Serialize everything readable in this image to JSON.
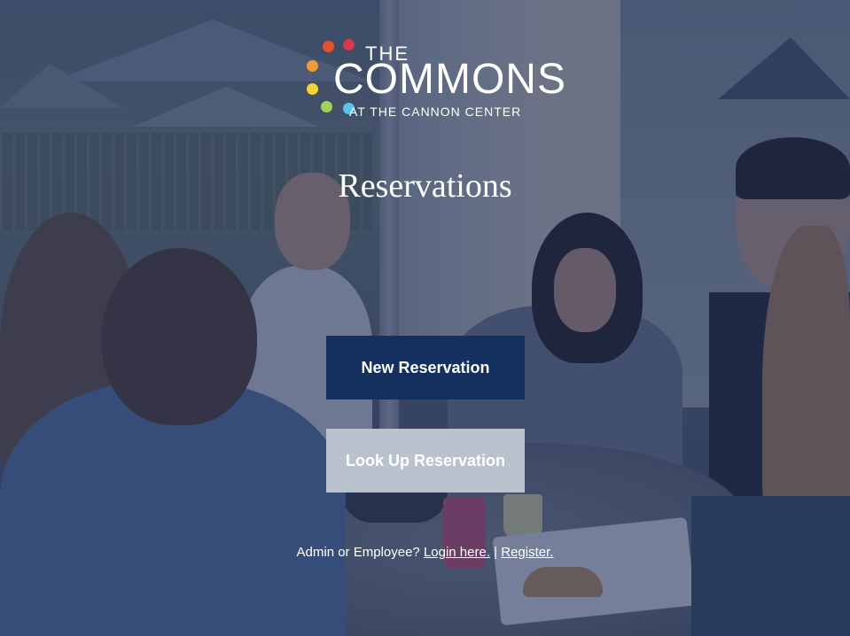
{
  "brand": {
    "the": "THE",
    "name": "COMMONS",
    "subtitle": "AT THE CANNON CENTER",
    "dot_colors": [
      "#e2532d",
      "#d63a4e",
      "#f09a3a",
      "#f4d23a",
      "#9fd15b",
      "#5bc2ea"
    ]
  },
  "page": {
    "title": "Reservations"
  },
  "actions": {
    "new_reservation_label": "New Reservation",
    "lookup_reservation_label": "Look Up Reservation"
  },
  "footer": {
    "prompt": "Admin or Employee?",
    "login_label": "Login here.",
    "separator": "|",
    "register_label": "Register."
  },
  "colors": {
    "primary_button": "#13305e",
    "secondary_button": "#b9c2cd",
    "overlay": "rgba(22, 38, 84, 0.55)"
  }
}
